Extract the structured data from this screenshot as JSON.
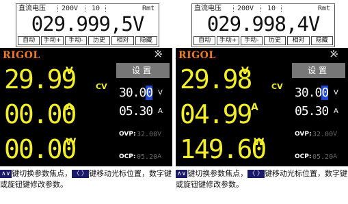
{
  "panels": [
    {
      "dmm": {
        "mode": "直流电压",
        "range": "200V",
        "rate": "10",
        "remote": "Rmt",
        "reading": "029.999,5V",
        "softkeys": [
          "自动",
          "手动+",
          "手动-",
          "历史",
          "相对",
          "隐藏"
        ]
      },
      "psu": {
        "brand": "RIGOL",
        "voltage": "29.99",
        "current": "00.00",
        "power": "00.00",
        "units": {
          "v": "V",
          "a": "A",
          "w": "W"
        },
        "mode": "CV",
        "settings_title": "设置",
        "set_voltage_prefix": "30.0",
        "set_voltage_cursor": "0",
        "set_voltage_unit": "V",
        "set_current": "05.30",
        "set_current_unit": "A",
        "ovp_label": "OVP:",
        "ovp_value": "32.00",
        "ovp_unit": "V",
        "ocp_label": "OCP:",
        "ocp_value": "05.20",
        "ocp_unit": "A"
      },
      "help": {
        "up_down": "∧∨",
        "text1": "键切换参数焦点，",
        "left_right": "〈 〉",
        "text2": "键移动光标位置，数字键或旋钮键修改参数。"
      }
    },
    {
      "dmm": {
        "mode": "直流电压",
        "range": "200V",
        "rate": "10",
        "remote": "Rmt",
        "reading": "029.998,4V",
        "softkeys": [
          "自动",
          "手动+",
          "手动-",
          "历史",
          "相对",
          "隐藏"
        ]
      },
      "psu": {
        "brand": "RIGOL",
        "voltage": "29.98",
        "current": "04.99",
        "power": "149.60",
        "units": {
          "v": "V",
          "a": "A",
          "w": "W"
        },
        "mode": "CV",
        "settings_title": "设置",
        "set_voltage_prefix": "30.0",
        "set_voltage_cursor": "0",
        "set_voltage_unit": "V",
        "set_current": "05.30",
        "set_current_unit": "A",
        "ovp_label": "OVP:",
        "ovp_value": "32.00",
        "ovp_unit": "V",
        "ocp_label": "OCP:",
        "ocp_value": "05.20",
        "ocp_unit": "A"
      },
      "help": {
        "up_down": "∧∨",
        "text1": "键切换参数焦点，",
        "left_right": "〈 〉",
        "text2": "键移动光标位置，数字键或旋钮键修改参数。"
      }
    }
  ]
}
